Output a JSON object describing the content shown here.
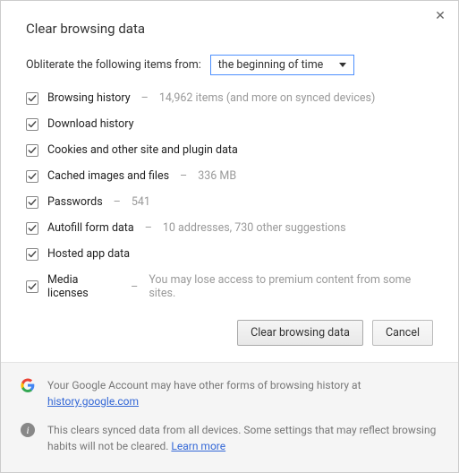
{
  "title": "Clear browsing data",
  "obliterate_label": "Obliterate the following items from:",
  "time_range_selected": "the beginning of time",
  "items": [
    {
      "label": "Browsing history",
      "note": "14,962 items (and more on synced devices)"
    },
    {
      "label": "Download history",
      "note": ""
    },
    {
      "label": "Cookies and other site and plugin data",
      "note": ""
    },
    {
      "label": "Cached images and files",
      "note": "336 MB"
    },
    {
      "label": "Passwords",
      "note": "541"
    },
    {
      "label": "Autofill form data",
      "note": "10 addresses, 730 other suggestions"
    },
    {
      "label": "Hosted app data",
      "note": ""
    },
    {
      "label": "Media licenses",
      "note": "You may lose access to premium content from some sites."
    }
  ],
  "buttons": {
    "clear": "Clear browsing data",
    "cancel": "Cancel"
  },
  "footer": {
    "google_text": "Your Google Account may have other forms of browsing history at ",
    "google_link": "history.google.com",
    "info_text": "This clears synced data from all devices. Some settings that may reflect browsing habits will not be cleared. ",
    "learn_more": "Learn more"
  }
}
